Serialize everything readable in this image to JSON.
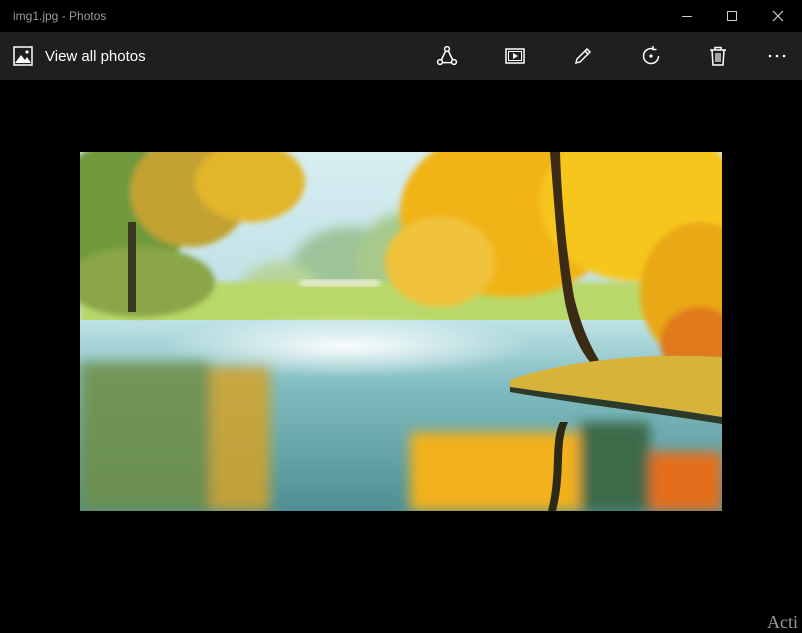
{
  "window": {
    "title": "img1.jpg - Photos",
    "controls": [
      "minimize",
      "maximize",
      "close"
    ]
  },
  "toolbar": {
    "view_all_label": "View all photos",
    "view_all_icon": "photos-icon",
    "actions": [
      {
        "name": "share",
        "icon": "share-icon"
      },
      {
        "name": "slideshow",
        "icon": "slideshow-icon"
      },
      {
        "name": "edit",
        "icon": "pencil-icon"
      },
      {
        "name": "rotate",
        "icon": "rotate-icon"
      },
      {
        "name": "delete",
        "icon": "trash-icon"
      },
      {
        "name": "more",
        "icon": "more-icon"
      }
    ]
  },
  "photo": {
    "subject": "autumn lake landscape"
  },
  "watermark": {
    "text": "Acti"
  },
  "colors": {
    "background": "#000000",
    "toolbar": "#1f1f1f",
    "text": "#ffffff",
    "title_text": "#9a9a9a"
  }
}
